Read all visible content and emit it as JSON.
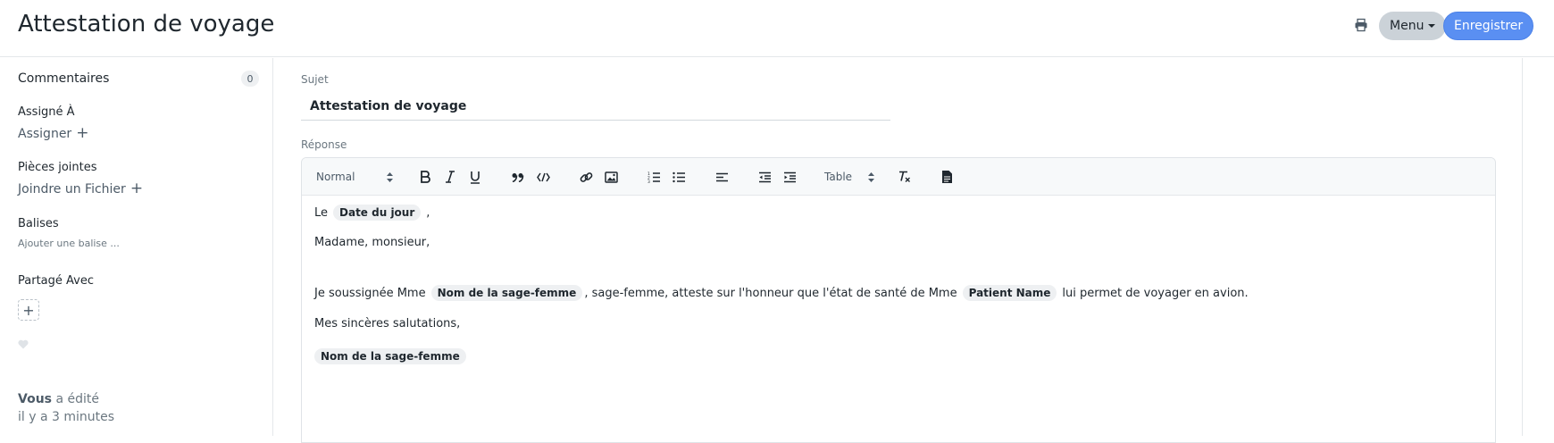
{
  "header": {
    "title": "Attestation de voyage",
    "menu_label": "Menu",
    "save_label": "Enregistrer"
  },
  "sidebar": {
    "comments_label": "Commentaires",
    "comments_count": "0",
    "assigned_label": "Assigné À",
    "assign_action": "Assigner",
    "attachments_label": "Pièces jointes",
    "attach_action": "Joindre un Fichier",
    "tags_label": "Balises",
    "tags_placeholder": "Ajouter une balise ...",
    "shared_label": "Partagé Avec",
    "activity_user": "Vous",
    "activity_text": "a édité",
    "activity_time": "il y a 3 minutes"
  },
  "form": {
    "subject_label": "Sujet",
    "subject_value": "Attestation de voyage",
    "response_label": "Réponse"
  },
  "toolbar": {
    "format_select": "Normal",
    "table_select": "Table"
  },
  "body": {
    "line1_prefix": "Le",
    "line1_pill": "Date du jour",
    "line1_suffix": ",",
    "line2": "Madame, monsieur,",
    "line3_prefix": "Je soussignée Mme",
    "line3_pill1": "Nom de la sage-femme",
    "line3_mid": ", sage-femme, atteste sur l'honneur que l'état de santé de Mme",
    "line3_pill2": "Patient Name",
    "line3_suffix": "lui permet de voyager en avion.",
    "line4": "Mes sincères salutations,",
    "line5_pill": "Nom de la sage-femme"
  },
  "colors": {
    "primary": "#5a8ff2",
    "menu_bg": "#cbd2d8",
    "pill_bg": "#eef0f2"
  },
  "icons": [
    "printer-icon",
    "caret-down-icon",
    "bold-icon",
    "italic-icon",
    "underline-icon",
    "blockquote-icon",
    "code-icon",
    "link-icon",
    "image-icon",
    "ordered-list-icon",
    "bullet-list-icon",
    "align-left-icon",
    "outdent-icon",
    "indent-icon",
    "clear-format-icon",
    "document-icon",
    "heart-icon",
    "plus-icon"
  ]
}
